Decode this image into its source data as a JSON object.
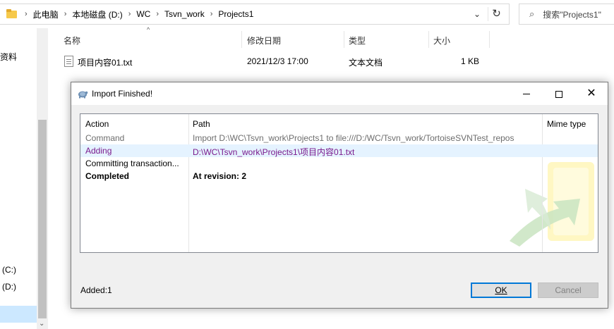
{
  "explorer": {
    "breadcrumbs": [
      "此电脑",
      "本地磁盘 (D:)",
      "WC",
      "Tsvn_work",
      "Projects1"
    ],
    "search_placeholder": "搜索\"Projects1\"",
    "columns": [
      "名称",
      "修改日期",
      "类型",
      "大小"
    ],
    "files": [
      {
        "name": "项目内容01.txt",
        "modified": "2021/12/3 17:00",
        "type": "文本文档",
        "size": "1 KB"
      }
    ],
    "nav": {
      "item_partial": "资料",
      "drive_c": "(C:)",
      "drive_d": "(D:)"
    }
  },
  "dialog": {
    "title": "Import Finished!",
    "columns": {
      "action": "Action",
      "path": "Path",
      "mime": "Mime type"
    },
    "rows": [
      {
        "action": "Command",
        "path": "Import D:\\WC\\Tsvn_work\\Projects1 to file:///D:/WC/Tsvn_work/TortoiseSVNTest_repos",
        "style": "gray"
      },
      {
        "action": "Adding",
        "path": "D:\\WC\\Tsvn_work\\Projects1\\项目内容01.txt",
        "style": "purple"
      },
      {
        "action": "Committing transaction...",
        "path": "",
        "style": "normal"
      },
      {
        "action": "Completed",
        "path": "At revision: 2",
        "style": "bold"
      }
    ],
    "status": "Added:1",
    "ok_label": "OK",
    "cancel_label": "Cancel"
  },
  "colors": {
    "selection": "#cce8ff",
    "row_highlight": "#e5f3ff",
    "added_text": "#7a1a8c",
    "command_text": "#6d6d6d",
    "focus_border": "#0078d7"
  }
}
